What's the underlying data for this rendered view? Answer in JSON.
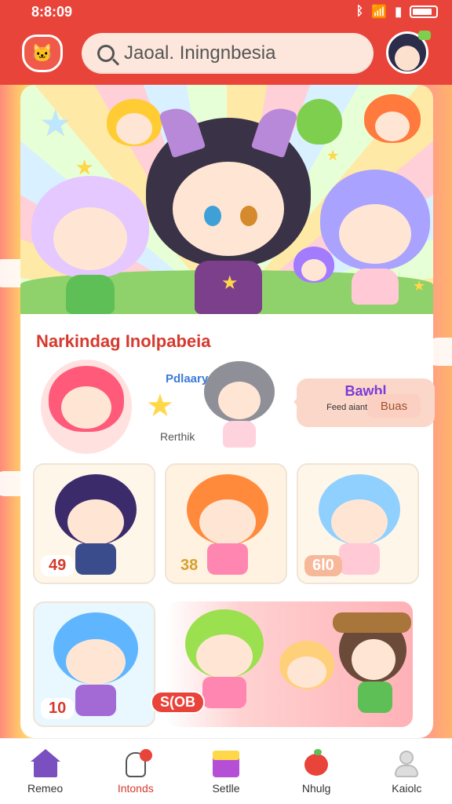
{
  "status_bar": {
    "time": "8:8:09",
    "signal_icon": "bluetooth-icon",
    "wifi_icon": "wifi-icon",
    "battery_icon": "battery-icon"
  },
  "header": {
    "logo_icon": "cat-logo-icon",
    "search_placeholder": "Jaoal. Iningnbesia",
    "avatar_icon": "user-avatar-icon",
    "brand_color": "#e8443a"
  },
  "banner": {
    "theme": "chibi-cat-characters"
  },
  "section": {
    "title": "Narkindag Inolpabeia",
    "feature": {
      "label_a": "Pdlaary",
      "label_b": "Rerthik",
      "bubble_title": "Bawbl",
      "bubble_sub": "Feed aiantianu uouv"
    },
    "button_label": "Buas",
    "tiles": [
      {
        "number": "49"
      },
      {
        "number": "38"
      },
      {
        "number": "6l0"
      },
      {
        "number": "10"
      }
    ],
    "wide_tag": "S(OB"
  },
  "nav": {
    "items": [
      {
        "label": "Remeo",
        "icon": "home-icon",
        "active": false
      },
      {
        "label": "Intonds",
        "icon": "favorites-icon",
        "active": true
      },
      {
        "label": "Setlle",
        "icon": "box-icon",
        "active": false
      },
      {
        "label": "Nhulg",
        "icon": "apple-icon",
        "active": false
      },
      {
        "label": "Kaiolc",
        "icon": "profile-icon",
        "active": false
      }
    ]
  }
}
